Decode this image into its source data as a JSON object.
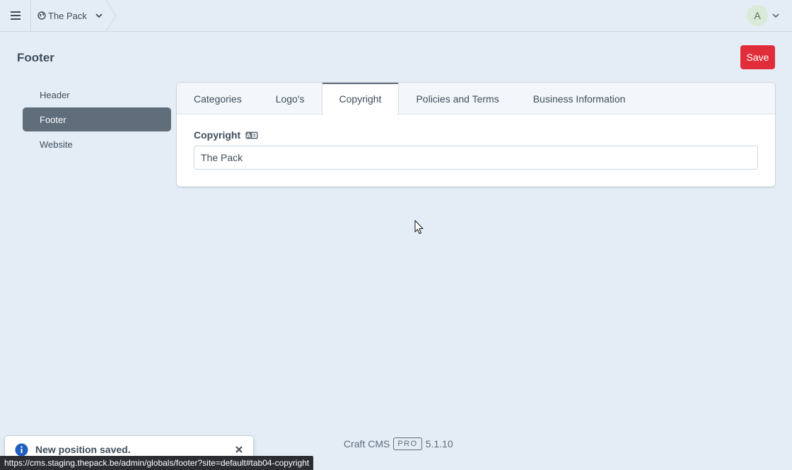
{
  "header": {
    "site_name": "The Pack",
    "avatar_initial": "A"
  },
  "page": {
    "title": "Footer",
    "save_label": "Save"
  },
  "sidebar": {
    "items": [
      {
        "label": "Header"
      },
      {
        "label": "Footer"
      },
      {
        "label": "Website"
      }
    ]
  },
  "tabs": [
    {
      "label": "Categories"
    },
    {
      "label": "Logo's"
    },
    {
      "label": "Copyright"
    },
    {
      "label": "Policies and Terms"
    },
    {
      "label": "Business Information"
    }
  ],
  "selected_tab": "Copyright",
  "field": {
    "label": "Copyright",
    "value": "The Pack"
  },
  "footer": {
    "app_name": "Craft CMS",
    "edition": "PRO",
    "version": "5.1.10"
  },
  "notification": {
    "message": "New position saved."
  },
  "status_url": "https://cms.staging.thepack.be/admin/globals/footer?site=default#tab04-copyright",
  "colors": {
    "accent_red": "#e12d39",
    "active_nav": "#606d7b",
    "background": "#e4edf6"
  }
}
